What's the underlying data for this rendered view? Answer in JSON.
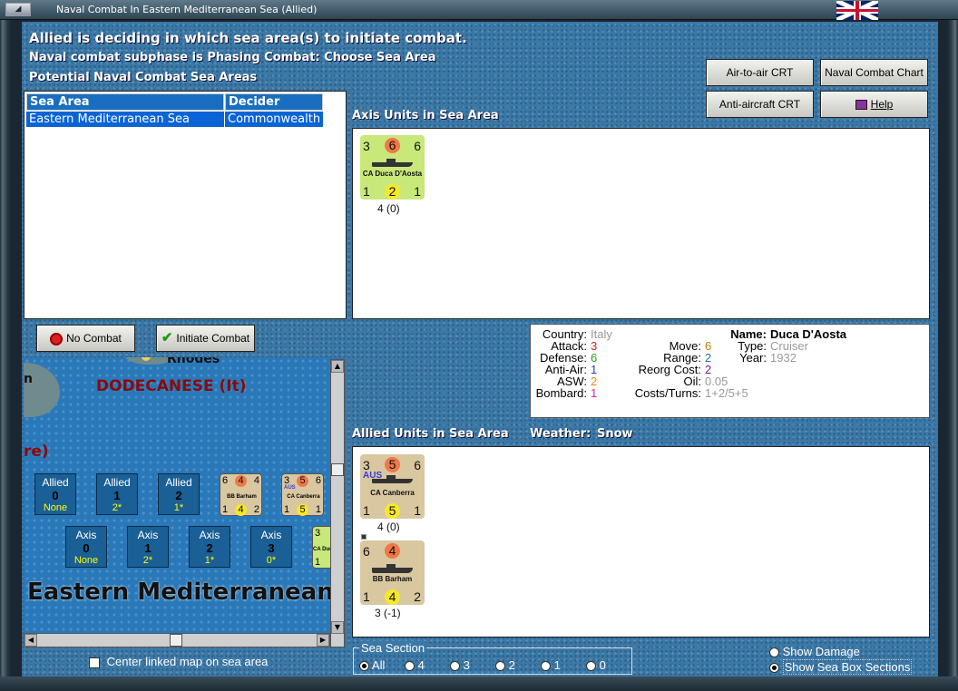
{
  "window": {
    "title": "Naval Combat In Eastern Mediterranean Sea (Allied)"
  },
  "header": {
    "line1": "Allied is deciding in which sea area(s) to initiate combat.",
    "line2": "Naval combat subphase is Phasing Combat: Choose Sea Area",
    "line3": "Potential Naval Combat Sea Areas"
  },
  "toolbar": {
    "air_to_air": "Air-to-air CRT",
    "naval_chart": "Naval Combat Chart",
    "anti_aircraft": "Anti-aircraft CRT",
    "help": "Help"
  },
  "sea_table": {
    "headers": [
      "Sea Area",
      "Decider"
    ],
    "rows": [
      [
        "Eastern Mediterranean Sea",
        "Commonwealth"
      ]
    ]
  },
  "buttons": {
    "no_combat": "No Combat",
    "initiate_combat": "Initiate Combat"
  },
  "axis_section": {
    "label": "Axis Units in Sea Area",
    "units": [
      {
        "tl": "3",
        "tc": "6",
        "tr": "6",
        "name": "CA Duca D'Aosta",
        "bl": "1",
        "bc": "2",
        "br": "1",
        "caption": "4 (0)"
      }
    ]
  },
  "info": {
    "country_label": "Country:",
    "country": "Italy",
    "attack_label": "Attack:",
    "attack": "3",
    "defense_label": "Defense:",
    "defense": "6",
    "antiair_label": "Anti-Air:",
    "antiair": "1",
    "asw_label": "ASW:",
    "asw": "2",
    "bombard_label": "Bombard:",
    "bombard": "1",
    "move_label": "Move:",
    "move": "6",
    "range_label": "Range:",
    "range": "2",
    "reorg_label": "Reorg Cost:",
    "reorg": "2",
    "oil_label": "Oil:",
    "oil": "0.05",
    "costs_label": "Costs/Turns:",
    "costs": "1+2/5+5",
    "name_label": "Name:",
    "name": "Duca D'Aosta",
    "type_label": "Type:",
    "type": "Cruiser",
    "year_label": "Year:",
    "year": "1932"
  },
  "allied_section": {
    "label": "Allied Units in Sea Area",
    "weather_label": "Weather:",
    "weather": "Snow",
    "units": [
      {
        "tl": "3",
        "tc": "5",
        "tr": "6",
        "nat": "AUS",
        "name": "CA Canberra",
        "bl": "1",
        "bc": "5",
        "br": "1",
        "caption": "4 (0)"
      },
      {
        "tl": "6",
        "tc": "4",
        "tr": "",
        "nat": "",
        "name": "BB Barham",
        "bl": "1",
        "bc": "4",
        "br": "2",
        "caption": "3 (-1)"
      }
    ]
  },
  "map": {
    "rhodes": "Rhodes",
    "dodecanese": "DODECANESE (It)",
    "partial_n": "n",
    "partial_re": "re)",
    "sea_name": "Eastern Mediterranean",
    "allied_boxes": [
      {
        "side": "Allied",
        "num": "0",
        "val": "None"
      },
      {
        "side": "Allied",
        "num": "1",
        "val": "2*"
      },
      {
        "side": "Allied",
        "num": "2",
        "val": "1*"
      }
    ],
    "axis_boxes": [
      {
        "side": "Axis",
        "num": "0",
        "val": "None"
      },
      {
        "side": "Axis",
        "num": "1",
        "val": "2*"
      },
      {
        "side": "Axis",
        "num": "2",
        "val": "1*"
      },
      {
        "side": "Axis",
        "num": "3",
        "val": "0*"
      }
    ],
    "mini_barham": {
      "tl": "6",
      "tc": "4",
      "tr": "4",
      "name": "BB Barham",
      "bl": "1",
      "bc": "4",
      "br": "2"
    },
    "mini_canberra": {
      "tl": "3",
      "tc": "5",
      "tr": "6",
      "nat": "AUS",
      "name": "CA Canberra",
      "bl": "1",
      "bc": "5",
      "br": "1"
    },
    "mini_duca": {
      "tl": "3",
      "name": "CA Duc",
      "bl": "1"
    }
  },
  "bottom": {
    "center_linked": "Center linked map on sea area",
    "sea_section_label": "Sea Section",
    "sea_options": [
      "All",
      "4",
      "3",
      "2",
      "1",
      "0"
    ],
    "sea_selected": "All",
    "show_damage": "Show Damage",
    "show_sea_box": "Show Sea Box Sections"
  },
  "colors": {
    "axis_counter": "#c8e87a",
    "allied_counter": "#d9c7a0",
    "selected_row": "#0a64d6",
    "attack_circle": "#f07848",
    "defense_circle": "#f5e82a"
  }
}
